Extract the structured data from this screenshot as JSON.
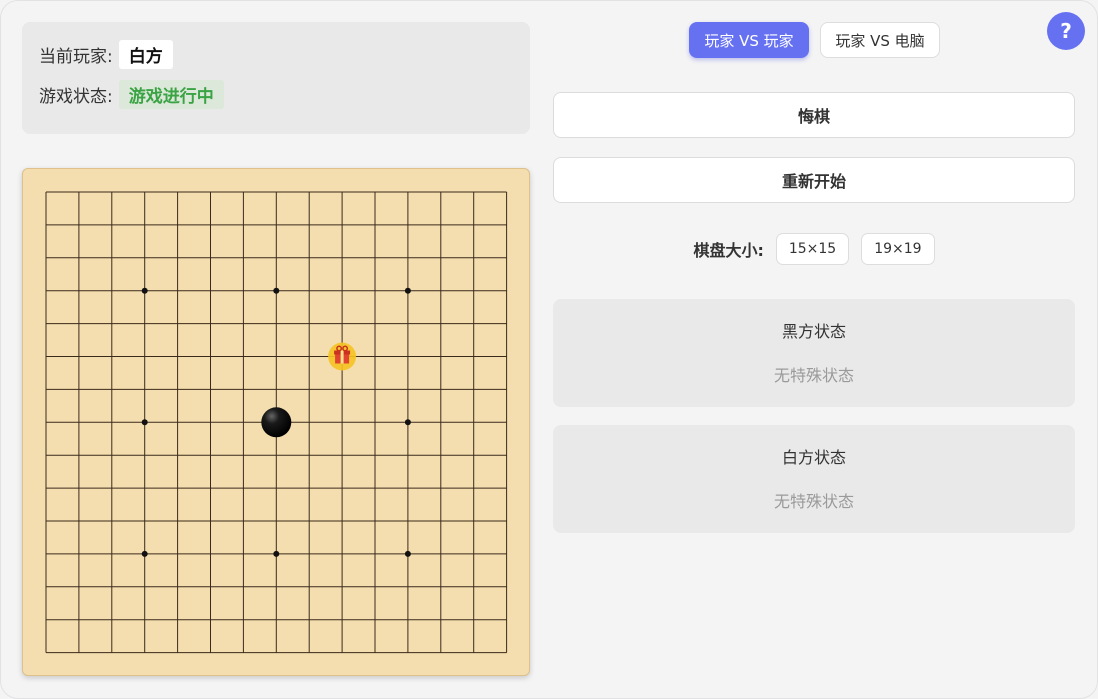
{
  "info": {
    "current_player_label": "当前玩家:",
    "current_player_value": "白方",
    "game_status_label": "游戏状态:",
    "game_status_value": "游戏进行中"
  },
  "modes": {
    "pvp_label": "玩家 VS 玩家",
    "pve_label": "玩家 VS 电脑",
    "active": "pvp"
  },
  "help_label": "?",
  "buttons": {
    "undo_label": "悔棋",
    "restart_label": "重新开始"
  },
  "board_size": {
    "label": "棋盘大小:",
    "options": [
      "15×15",
      "19×19"
    ],
    "selected": "15×15"
  },
  "black_state": {
    "title": "黑方状态",
    "text": "无特殊状态"
  },
  "white_state": {
    "title": "白方状态",
    "text": "无特殊状态"
  },
  "board": {
    "lines": 15,
    "star_points": [
      [
        3,
        3
      ],
      [
        3,
        7
      ],
      [
        3,
        11
      ],
      [
        7,
        3
      ],
      [
        7,
        11
      ],
      [
        11,
        3
      ],
      [
        11,
        7
      ],
      [
        11,
        11
      ]
    ],
    "stones": [
      {
        "row": 7,
        "col": 7,
        "color": "black"
      }
    ],
    "items": [
      {
        "row": 5,
        "col": 9,
        "icon": "gift-icon"
      }
    ],
    "colors": {
      "board": "#f4deb0",
      "line": "#3a2a1a",
      "accent": "#6671f2",
      "status_green": "#3aa343",
      "gift_bg": "#f6c324",
      "gift_red": "#e0432f"
    }
  }
}
